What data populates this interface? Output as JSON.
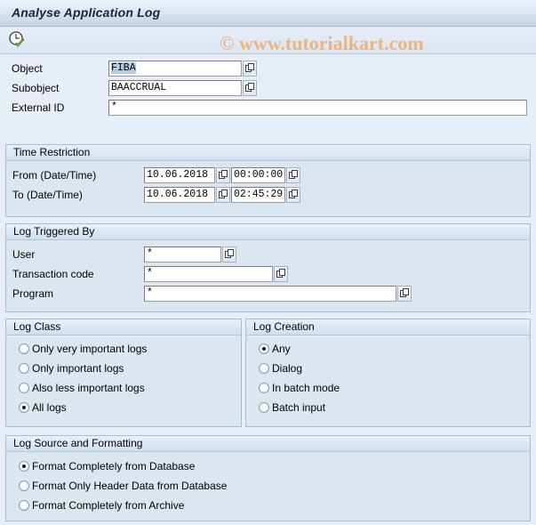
{
  "window": {
    "title": "Analyse Application Log"
  },
  "toolbar": {
    "execute_icon": "clock-check-icon",
    "execute_tooltip": "Execute"
  },
  "watermark": {
    "text": "© www.tutorialkart.com",
    "color": "#e8b583"
  },
  "selection": {
    "object": {
      "label": "Object",
      "value": "FIBA",
      "value_help_icon": "value-help-icon"
    },
    "subobject": {
      "label": "Subobject",
      "value": "BAACCRUAL",
      "value_help_icon": "value-help-icon"
    },
    "external_id": {
      "label": "External ID",
      "value": "*"
    }
  },
  "time_restriction": {
    "title": "Time Restriction",
    "from": {
      "label": "From (Date/Time)",
      "date": "10.06.2018",
      "time": "00:00:00"
    },
    "to": {
      "label": "To (Date/Time)",
      "date": "10.06.2018",
      "time": "02:45:29"
    }
  },
  "log_triggered_by": {
    "title": "Log Triggered By",
    "user": {
      "label": "User",
      "value": "*"
    },
    "transaction_code": {
      "label": "Transaction code",
      "value": "*"
    },
    "program": {
      "label": "Program",
      "value": "*"
    }
  },
  "log_class": {
    "title": "Log Class",
    "options": [
      {
        "label": "Only very important logs",
        "selected": false
      },
      {
        "label": "Only important logs",
        "selected": false
      },
      {
        "label": "Also less important logs",
        "selected": false
      },
      {
        "label": "All logs",
        "selected": true
      }
    ],
    "selected_value": "All logs"
  },
  "log_creation": {
    "title": "Log Creation",
    "options": [
      {
        "label": "Any",
        "selected": true
      },
      {
        "label": "Dialog",
        "selected": false
      },
      {
        "label": "In batch mode",
        "selected": false
      },
      {
        "label": "Batch input",
        "selected": false
      }
    ],
    "selected_value": "Any"
  },
  "log_source": {
    "title": "Log Source and Formatting",
    "options": [
      {
        "label": "Format Completely from Database",
        "selected": true
      },
      {
        "label": "Format Only Header Data from Database",
        "selected": false
      },
      {
        "label": "Format Completely from Archive",
        "selected": false
      }
    ],
    "selected_value": "Format Completely from Database"
  },
  "colors": {
    "page_background": "#e8eef7",
    "group_background": "#dbe6f0",
    "group_header": "#cfdff0",
    "titlebar": "#c3d4e8",
    "selection_highlight": "#b3cce6"
  }
}
